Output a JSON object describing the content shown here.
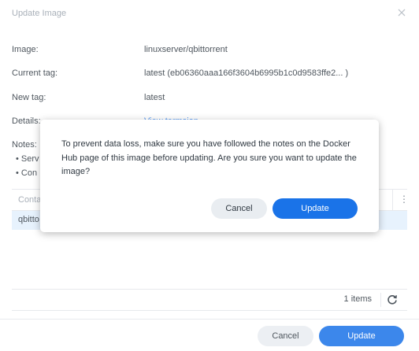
{
  "window": {
    "title": "Update Image"
  },
  "fields": {
    "image": {
      "label": "Image:",
      "value": "linuxserver/qbittorrent"
    },
    "current_tag": {
      "label": "Current tag:",
      "value": "latest (eb06360aaa166f3604b6995b1c0d9583ffe2... )"
    },
    "new_tag": {
      "label": "New tag:",
      "value": "latest"
    },
    "details": {
      "label": "Details:",
      "value": "View termsion"
    }
  },
  "notes": {
    "label": "Notes:",
    "items": [
      "Serv",
      "Con"
    ]
  },
  "table": {
    "columns": [
      "Conta"
    ],
    "rows": [
      [
        "qbitto"
      ]
    ],
    "count_text": "1 items"
  },
  "footer": {
    "cancel_label": "Cancel",
    "update_label": "Update"
  },
  "dialog": {
    "message": "To prevent data loss, make sure you have followed the notes on the Docker Hub page of this image before updating. Are you sure you want to update the image?",
    "cancel_label": "Cancel",
    "update_label": "Update"
  },
  "colors": {
    "primary": "#1a73e8",
    "cancel_bg": "#e9edf1",
    "selected_row": "#e3f0fd",
    "link": "#2f80ed"
  },
  "icons": {
    "close": "close-icon",
    "menu": "vertical-dots-icon",
    "refresh": "refresh-icon"
  }
}
